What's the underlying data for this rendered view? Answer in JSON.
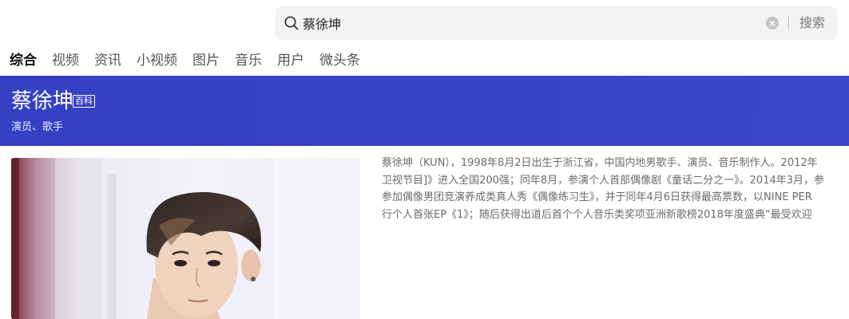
{
  "search": {
    "value": "蔡徐坤",
    "button_label": "搜索"
  },
  "tabs": [
    {
      "label": "综合",
      "active": true
    },
    {
      "label": "视频"
    },
    {
      "label": "资讯"
    },
    {
      "label": "小视频"
    },
    {
      "label": "图片"
    },
    {
      "label": "音乐"
    },
    {
      "label": "用户"
    },
    {
      "label": "微头条"
    }
  ],
  "banner": {
    "title": "蔡徐坤",
    "tag": "百科",
    "subtitle": "演员、歌手",
    "color": "#3540c2"
  },
  "bio": {
    "lines": [
      "蔡徐坤（KUN），1998年8月2日出生于浙江省，中国内地男歌手、演员、音乐制作人。2012年",
      "卫视节目]》进入全国200强；同年8月，参演个人首部偶像剧《童话二分之一》。2014年3月，参",
      "参加偶像男团竞演养成类真人秀《偶像练习生》，并于同年4月6日获得最高票数，以NINE PER",
      "行个人首张EP《1》；随后获得出道后首个个人音乐类奖项亚洲新歌榜2018年度盛典“最受欢迎"
    ]
  },
  "icons": {
    "search": "search-icon",
    "clear": "clear-icon"
  }
}
